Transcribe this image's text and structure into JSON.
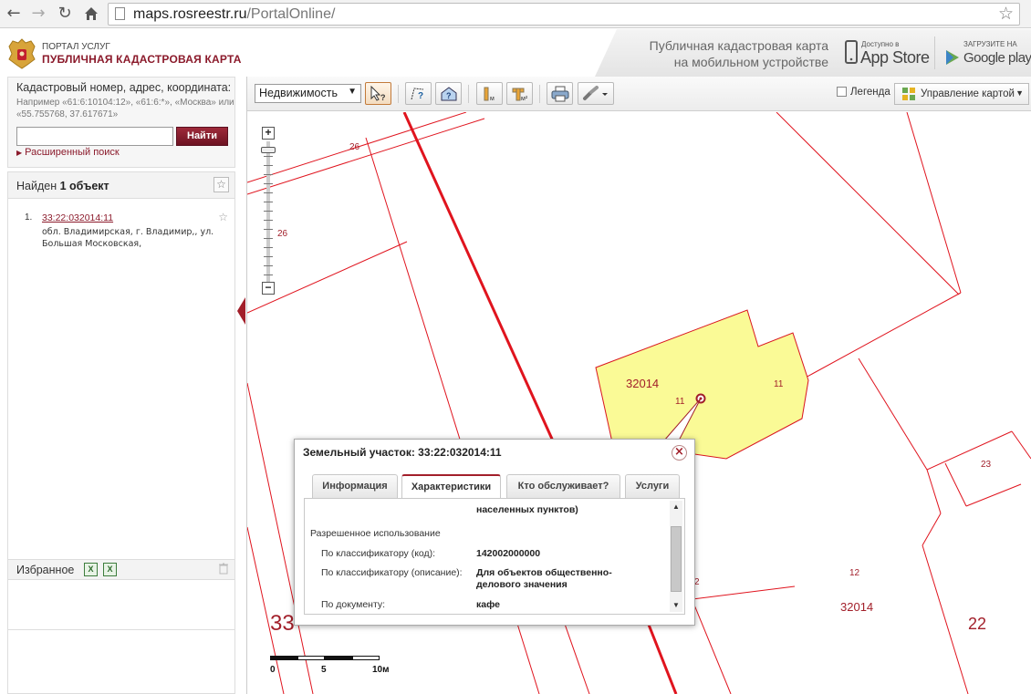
{
  "browser": {
    "url_host": "maps.rosreestr.ru",
    "url_path": "/PortalOnline/"
  },
  "header": {
    "portal_small": "ПОРТАЛ УСЛУГ",
    "portal_big": "ПУБЛИЧНАЯ КАДАСТРОВАЯ КАРТА",
    "mobile_line1": "Публичная кадастровая карта",
    "mobile_line2": "на мобильном устройстве",
    "appstore_small": "Доступно в",
    "appstore_big": "App Store",
    "gplay_small": "ЗАГРУЗИТЕ НА",
    "gplay_big": "Google play"
  },
  "search": {
    "title": "Кадастровый номер, адрес, координата:",
    "hint": "Например «61:6:10104:12», «61:6:*», «Москва» или «55.755768, 37.617671»",
    "input_value": "",
    "button_label": "Найти",
    "advanced_label": "Расширенный поиск"
  },
  "results": {
    "found_prefix": "Найден",
    "found_count": "1 объект",
    "items": [
      {
        "num": "1.",
        "link": "33:22:032014:11",
        "address": "обл. Владимирская, г. Владимир,, ул. Большая Московская,"
      }
    ]
  },
  "favorites": {
    "label": "Избранное"
  },
  "toolbar": {
    "select_value": "Недвижимость",
    "legend_label": "Легенда",
    "map_mgmt_label": "Управление картой"
  },
  "map": {
    "labels": {
      "l26a": "26",
      "l26b": "26",
      "l32014a": "32014",
      "l11a": "11",
      "l11b": "11",
      "l23": "23",
      "l12": "12",
      "l32014b": "32014",
      "l22": "22",
      "l33": "33",
      "l2": "2"
    },
    "scale": {
      "s0": "0",
      "s5": "5",
      "s10": "10м"
    },
    "parcel_fill": "#fafa96",
    "boundary_color": "#e0141e"
  },
  "popup": {
    "title": "Земельный участок: 33:22:032014:11",
    "tabs": [
      "Информация",
      "Характеристики",
      "Кто обслуживает?",
      "Услуги"
    ],
    "active_tab": "Характеристики",
    "partial_top": "населенных пунктов)",
    "section": "Разрешенное использование",
    "rows": [
      {
        "label": "По классификатору (код):",
        "value": "142002000000"
      },
      {
        "label": "По классификатору (описание):",
        "value": "Для объектов общественно-делового значения"
      },
      {
        "label": "По документу:",
        "value": "кафе"
      }
    ]
  }
}
